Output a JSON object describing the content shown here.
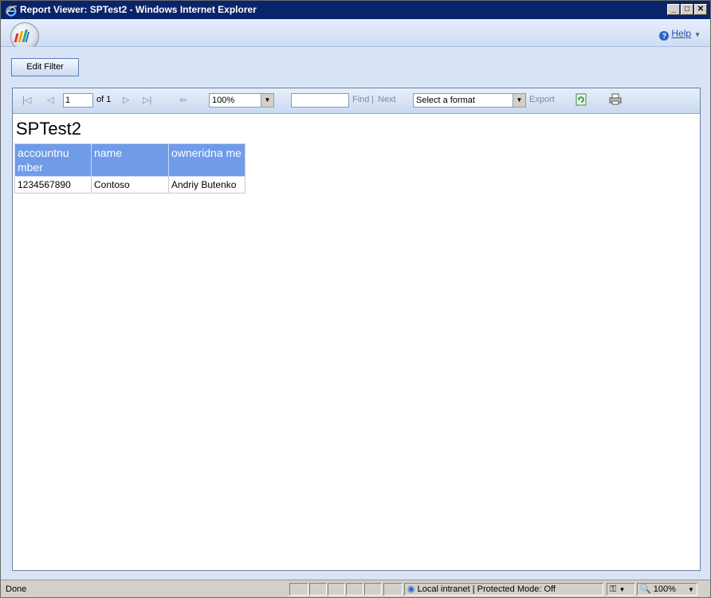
{
  "window": {
    "title": "Report Viewer: SPTest2 - Windows Internet Explorer"
  },
  "app": {
    "help_label": "Help"
  },
  "actions": {
    "edit_filter_label": "Edit Filter"
  },
  "toolbar": {
    "page_value": "1",
    "of_pages": "of 1",
    "zoom_value": "100%",
    "find_value": "",
    "find_label": "Find",
    "sep": "|",
    "next_label": "Next",
    "format_value": "Select a format",
    "export_label": "Export"
  },
  "report": {
    "title": "SPTest2",
    "columns": [
      "accountnu mber",
      "name",
      "owneridna me"
    ],
    "rows": [
      [
        "1234567890",
        "Contoso",
        "Andriy Butenko"
      ]
    ]
  },
  "status": {
    "text": "Done",
    "zone": "Local intranet | Protected Mode: Off",
    "zoom": "100%"
  },
  "colors": {
    "header_bg": "#6f9be9",
    "titlebar": "#0a246a"
  }
}
